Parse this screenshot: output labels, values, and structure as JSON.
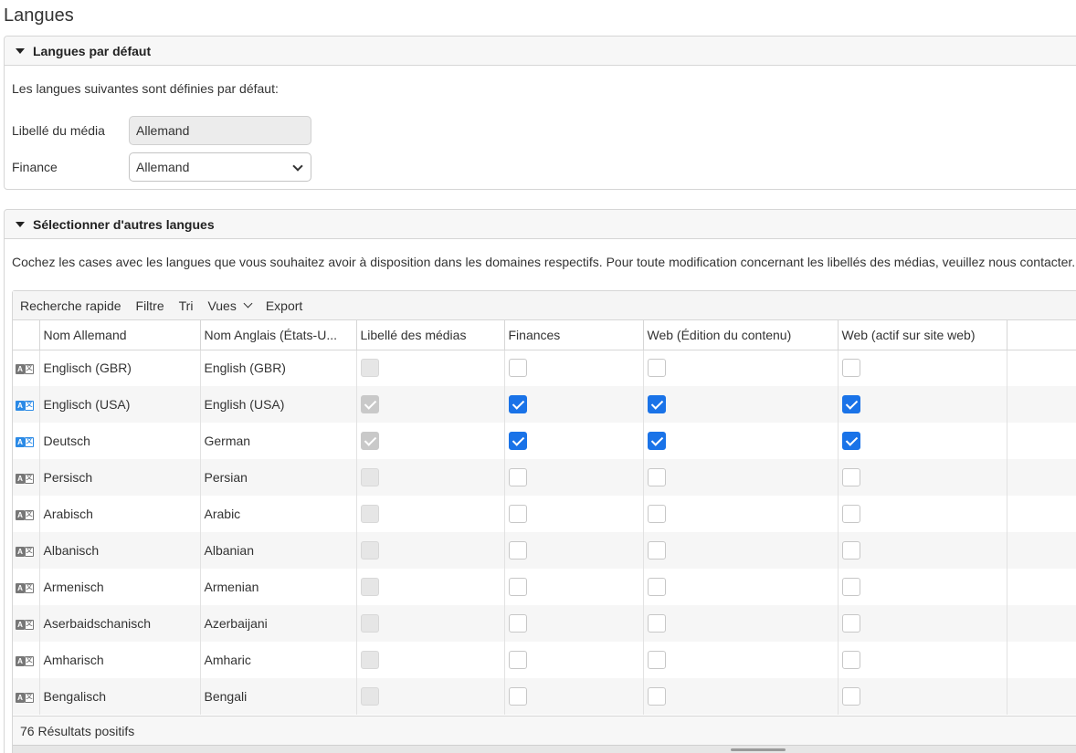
{
  "page": {
    "title": "Langues"
  },
  "defaults_panel": {
    "title": "Langues par défaut",
    "intro": "Les langues suivantes sont définies par défaut:",
    "fields": [
      {
        "label": "Libellé du média",
        "value": "Allemand"
      },
      {
        "label": "Finance",
        "value": "Allemand"
      }
    ]
  },
  "others_panel": {
    "title": "Sélectionner d'autres langues",
    "intro": "Cochez les cases avec les langues que vous souhaitez avoir à disposition dans les domaines respectifs. Pour toute modification concernant les libellés des médias, veuillez nous contacter."
  },
  "toolbar": {
    "quick_search": "Recherche rapide",
    "filter": "Filtre",
    "sort": "Tri",
    "views": "Vues",
    "export": "Export"
  },
  "table": {
    "columns": [
      "Nom Allemand",
      "Nom Anglais (États-U...",
      "Libellé des médias",
      "Finances",
      "Web (Édition du contenu)",
      "Web (actif sur site web)"
    ],
    "rows": [
      {
        "icon": "language-icon",
        "active": false,
        "de": "Englisch (GBR)",
        "en": "English (GBR)",
        "media": false,
        "finance": false,
        "web_edit": false,
        "web_live": false
      },
      {
        "icon": "language-icon",
        "active": true,
        "de": "Englisch (USA)",
        "en": "English (USA)",
        "media": true,
        "finance": true,
        "web_edit": true,
        "web_live": true
      },
      {
        "icon": "language-icon",
        "active": true,
        "de": "Deutsch",
        "en": "German",
        "media": true,
        "finance": true,
        "web_edit": true,
        "web_live": true
      },
      {
        "icon": "language-icon",
        "active": false,
        "de": "Persisch",
        "en": "Persian",
        "media": false,
        "finance": false,
        "web_edit": false,
        "web_live": false
      },
      {
        "icon": "language-icon",
        "active": false,
        "de": "Arabisch",
        "en": "Arabic",
        "media": false,
        "finance": false,
        "web_edit": false,
        "web_live": false
      },
      {
        "icon": "language-icon",
        "active": false,
        "de": "Albanisch",
        "en": "Albanian",
        "media": false,
        "finance": false,
        "web_edit": false,
        "web_live": false
      },
      {
        "icon": "language-icon",
        "active": false,
        "de": "Armenisch",
        "en": "Armenian",
        "media": false,
        "finance": false,
        "web_edit": false,
        "web_live": false
      },
      {
        "icon": "language-icon",
        "active": false,
        "de": "Aserbaidschanisch",
        "en": "Azerbaijani",
        "media": false,
        "finance": false,
        "web_edit": false,
        "web_live": false
      },
      {
        "icon": "language-icon",
        "active": false,
        "de": "Amharisch",
        "en": "Amharic",
        "media": false,
        "finance": false,
        "web_edit": false,
        "web_live": false
      },
      {
        "icon": "language-icon",
        "active": false,
        "de": "Bengalisch",
        "en": "Bengali",
        "media": false,
        "finance": false,
        "web_edit": false,
        "web_live": false
      }
    ],
    "footer": "76 Résultats positifs"
  },
  "colors": {
    "accent": "#1a73e8",
    "icon_active": "#2b8ae6",
    "icon_inactive": "#777777"
  }
}
